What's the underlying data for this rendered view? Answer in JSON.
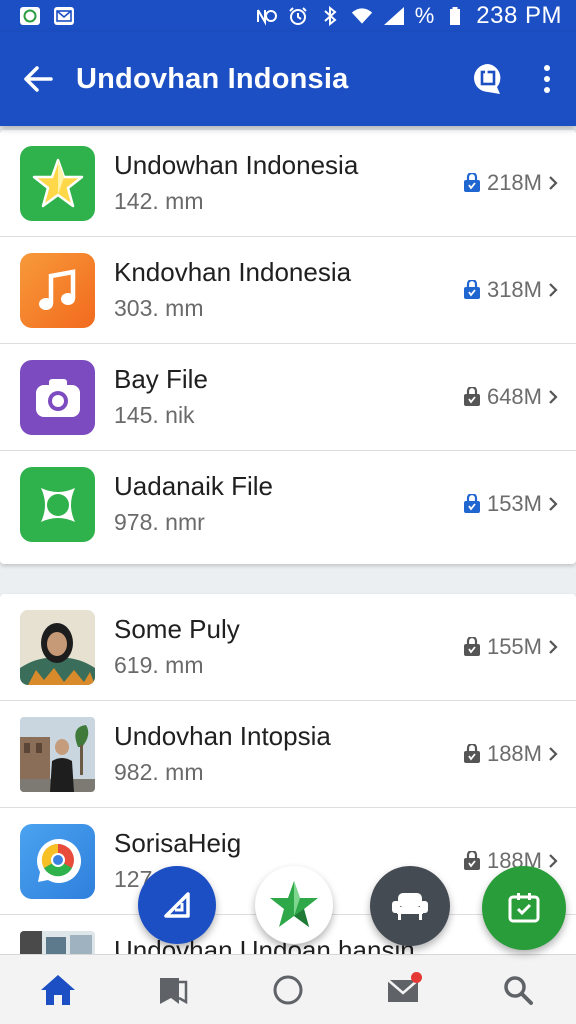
{
  "status_bar": {
    "time": "238 PM",
    "battery_symbol": "%",
    "left_icons": [
      "whatsapp-icon",
      "mail-icon"
    ],
    "right_icons": [
      "nfc-icon",
      "alarm-icon",
      "bluetooth-icon",
      "wifi-icon",
      "signal-icon",
      "battery-icon"
    ]
  },
  "app_bar": {
    "title": "Undovhan Indonsia",
    "back_icon": "arrow-back-icon",
    "action_icon": "chat-icon",
    "menu_icon": "more-vert-icon",
    "color": "#1c4fc4"
  },
  "card1": {
    "items": [
      {
        "title": "Undowhan Indonesia",
        "subtitle": "142. mm",
        "size": "218M",
        "icon": "star-icon",
        "icon_bg": "#2fb24c",
        "lock_color": "#1f66d1"
      },
      {
        "title": "Kndovhan Indonesia",
        "subtitle": "303. mm",
        "size": "318M",
        "icon": "music-note-icon",
        "icon_bg": "#f5822a",
        "lock_color": "#1f66d1"
      },
      {
        "title": "Bay File",
        "subtitle": "145. nik",
        "size": "648M",
        "icon": "camera-icon",
        "icon_bg": "#7b4bbf",
        "lock_color": "#555555"
      },
      {
        "title": "Uadanaik File",
        "subtitle": "978. nmr",
        "size": "153M",
        "icon": "frame-icon",
        "icon_bg": "#2fb24c",
        "lock_color": "#1f66d1"
      }
    ]
  },
  "card2": {
    "items": [
      {
        "title": "Some Puly",
        "subtitle": "619. mm",
        "size": "155M",
        "icon": "profile-photo",
        "lock_color": "#555555"
      },
      {
        "title": "Undovhan Intopsia",
        "subtitle": "982. mm",
        "size": "188M",
        "icon": "street-photo",
        "lock_color": "#555555"
      },
      {
        "title": "SorisaHeig",
        "subtitle": "127",
        "size": "188M",
        "icon": "chrome-icon",
        "icon_bg": "#3c8ee8",
        "lock_color": "#555555"
      },
      {
        "title": "Undovhan Undoan hansin",
        "subtitle": "",
        "size": "",
        "icon": "thumbnail-photo",
        "lock_color": "#555555"
      }
    ]
  },
  "fabs": [
    {
      "icon": "compose-icon",
      "color": "#1c4fc4"
    },
    {
      "icon": "star-icon",
      "color": "#ffffff"
    },
    {
      "icon": "sofa-icon",
      "color": "#444b52"
    },
    {
      "icon": "calendar-check-icon",
      "color": "#2a9d3b"
    }
  ],
  "bottom_nav": [
    {
      "icon": "home-icon",
      "active": true
    },
    {
      "icon": "bookmark-icon",
      "active": false
    },
    {
      "icon": "circle-icon",
      "active": false
    },
    {
      "icon": "mail-icon",
      "active": false,
      "badge": true
    },
    {
      "icon": "search-icon",
      "active": false
    }
  ]
}
